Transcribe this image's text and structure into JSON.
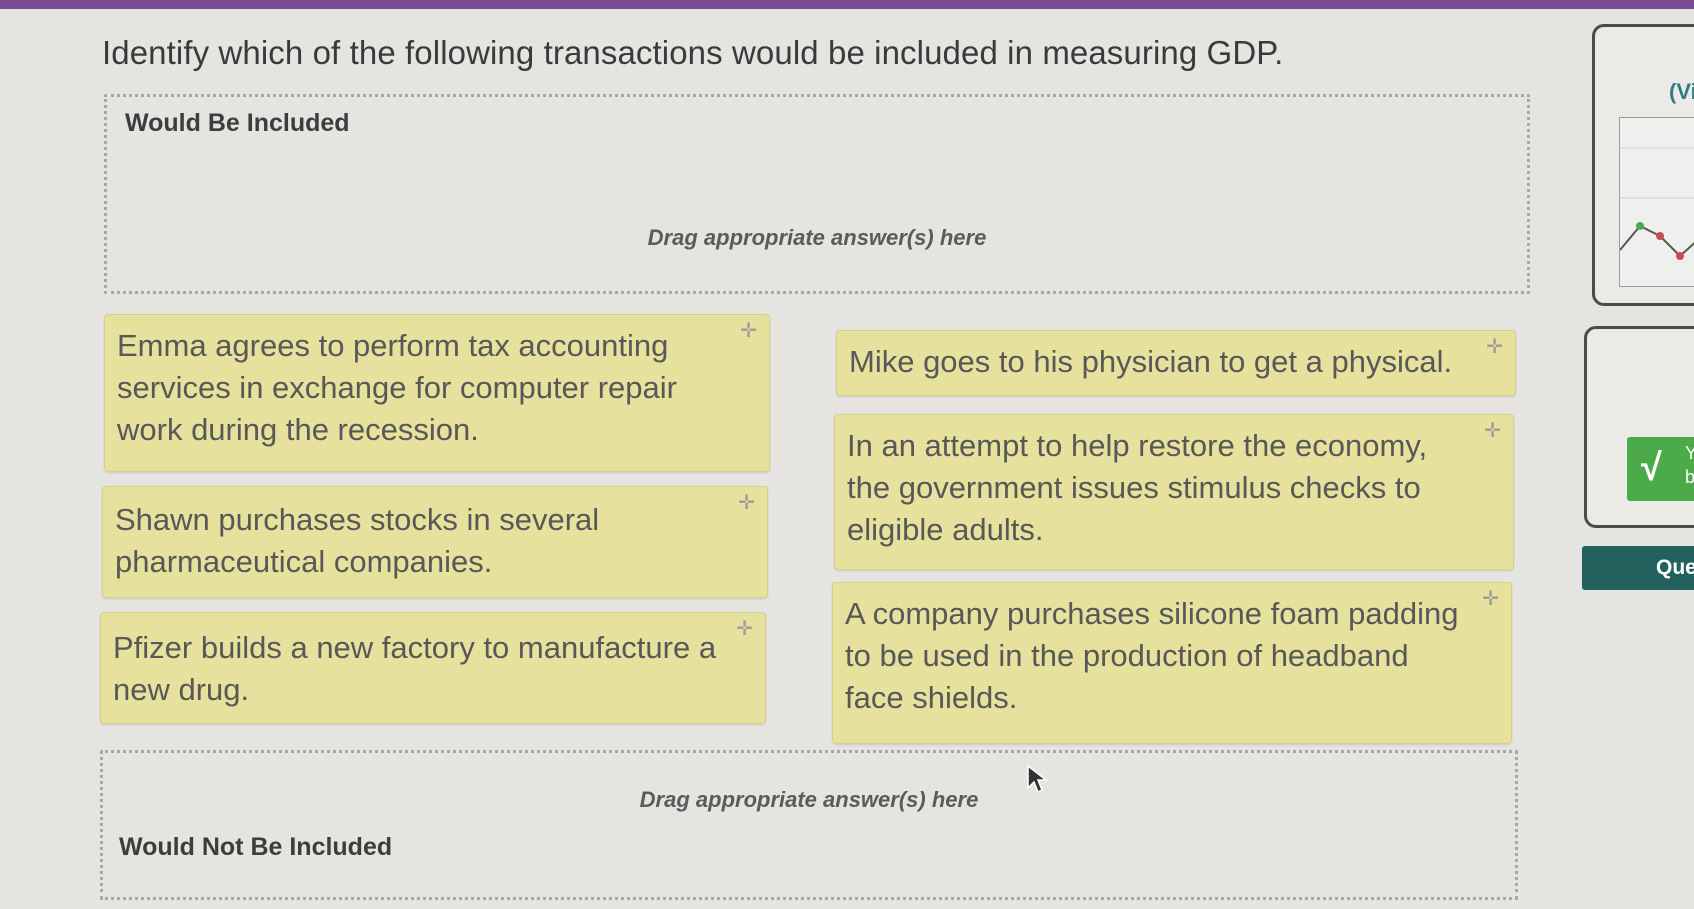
{
  "question": {
    "text": "Identify which of the following transactions would be included in measuring GDP."
  },
  "zones": {
    "included": {
      "title": "Would Be Included",
      "hint": "Drag appropriate answer(s) here"
    },
    "not_included": {
      "title": "Would Not Be Included",
      "hint": "Drag appropriate answer(s) here"
    }
  },
  "cards": [
    {
      "text": "Emma agrees to perform tax accounting services in exchange for computer repair work during the recession."
    },
    {
      "text": "Shawn purchases stocks in several pharmaceutical companies."
    },
    {
      "text": "Pfizer builds a new factory to manufacture a new drug."
    },
    {
      "text": "Mike goes to his physician to get a physical."
    },
    {
      "text": "In an attempt to help restore the economy, the government issues stimulus checks to eligible adults."
    },
    {
      "text": "A company purchases silicone foam padding to be used in the production of headband face shields."
    }
  ],
  "card_icon": "plus-icon",
  "side_panel": {
    "panel_label": "(Vi",
    "badge_line1": "Y",
    "badge_line2": "b",
    "question_button": "Que"
  },
  "colors": {
    "card_bg": "#e6e29d",
    "accent_teal": "#23625c",
    "correct_green": "#4caa48",
    "top_bar": "#7a4a94"
  }
}
